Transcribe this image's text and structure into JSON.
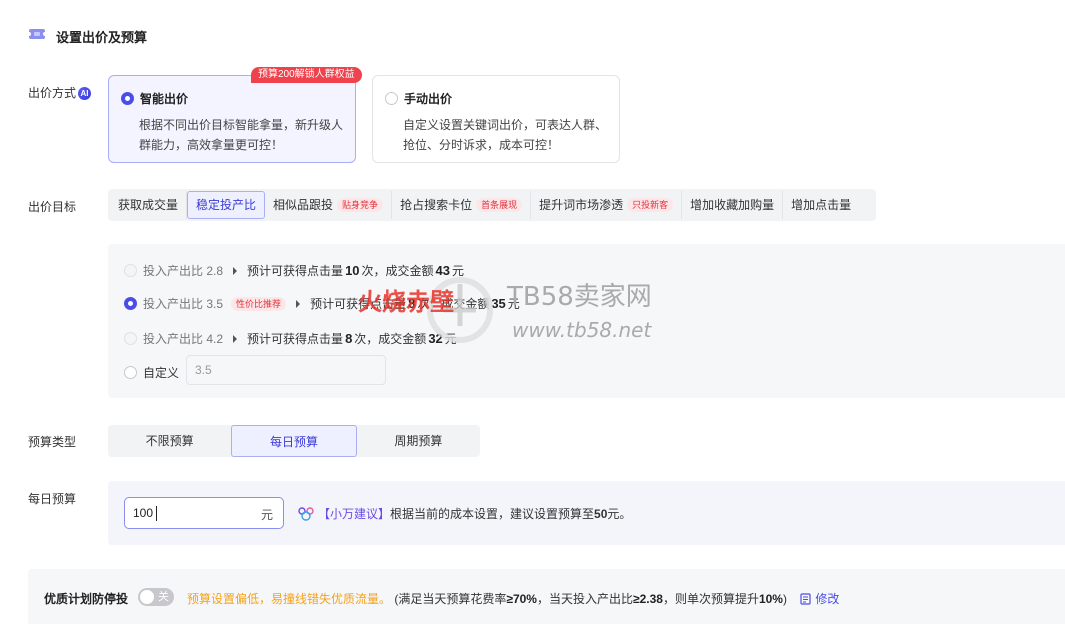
{
  "section": {
    "title": "设置出价及预算",
    "icon": "ticket-icon"
  },
  "bid_method": {
    "label": "出价方式",
    "ai_badge": "AI",
    "promo_badge": "预算200解锁人群权益",
    "options": [
      {
        "title": "智能出价",
        "desc": "根据不同出价目标智能拿量，新升级人群能力，高效拿量更可控！",
        "selected": true
      },
      {
        "title": "手动出价",
        "desc": "自定义设置关键词出价，可表达人群、抢位、分时诉求，成本可控！",
        "selected": false
      }
    ]
  },
  "bid_goal": {
    "label": "出价目标",
    "tabs": [
      {
        "label": "获取成交量",
        "tag": ""
      },
      {
        "label": "稳定投产比",
        "tag": "",
        "active": true
      },
      {
        "label": "相似品跟投",
        "tag": "贴身竞争"
      },
      {
        "label": "抢占搜索卡位",
        "tag": "首条展现"
      },
      {
        "label": "提升词市场渗透",
        "tag": "只投新客"
      },
      {
        "label": "增加收藏加购量",
        "tag": ""
      },
      {
        "label": "增加点击量",
        "tag": ""
      }
    ]
  },
  "roi": {
    "options": [
      {
        "label": "投入产出比",
        "value": "2.8",
        "tag": "",
        "est_prefix": "预计可获得点击量",
        "clicks": "10",
        "clicks_unit": "次，成交金额",
        "amount": "43",
        "amount_unit": "元",
        "selected": false
      },
      {
        "label": "投入产出比",
        "value": "3.5",
        "tag": "性价比推荐",
        "est_prefix": "预计可获得点击量",
        "clicks": "8",
        "clicks_unit": "次，成交金额",
        "amount": "35",
        "amount_unit": "元",
        "selected": true
      },
      {
        "label": "投入产出比",
        "value": "4.2",
        "tag": "",
        "est_prefix": "预计可获得点击量",
        "clicks": "8",
        "clicks_unit": "次，成交金额",
        "amount": "32",
        "amount_unit": "元",
        "selected": false
      }
    ],
    "custom_label": "自定义",
    "custom_placeholder": "3.5"
  },
  "budget_type": {
    "label": "预算类型",
    "tabs": [
      {
        "label": "不限预算",
        "active": false
      },
      {
        "label": "每日预算",
        "active": true
      },
      {
        "label": "周期预算",
        "active": false
      }
    ]
  },
  "daily_budget": {
    "label": "每日预算",
    "value": "100",
    "unit": "元",
    "tip_name": "【小万建议】",
    "tip_text": "根据当前的成本设置，建议设置预算至",
    "tip_value": "50",
    "tip_unit": "元。"
  },
  "stop_plan": {
    "label": "优质计划防停投",
    "toggle_label": "关",
    "warning": "预算设置偏低，易撞线错失优质流量。",
    "cond_1": "(满足当天预算花费率",
    "cond_1_val": "≥70%",
    "cond_2": "，当天投入产出比",
    "cond_2_val": "≥2.38",
    "cond_3": "，则单次预算提升",
    "cond_3_val": "10%",
    "cond_end": ")",
    "edit_label": "修改"
  },
  "watermark": {
    "brand": "TB58卖家网",
    "url": "www.tb58.net",
    "stamp": "火烧赤壁"
  },
  "colors": {
    "accent": "#4b4de8",
    "promo": "#f0424c",
    "warning": "#f5a21b",
    "tip": "#6b4ae8"
  }
}
